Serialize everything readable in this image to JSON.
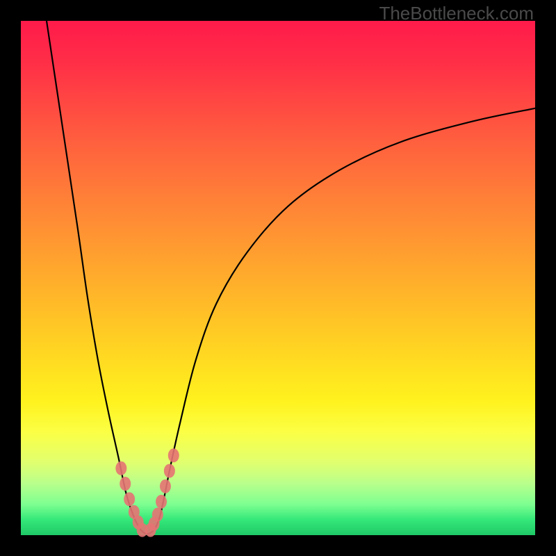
{
  "watermark": "TheBottleneck.com",
  "chart_data": {
    "type": "line",
    "title": "",
    "xlabel": "",
    "ylabel": "",
    "xlim": [
      0,
      100
    ],
    "ylim": [
      0,
      100
    ],
    "grid": false,
    "series": [
      {
        "name": "bottleneck-curve",
        "x": [
          5,
          8,
          11,
          13,
          15,
          17,
          19,
          20.5,
          22,
          23.2,
          24.2,
          25,
          26,
          27,
          28,
          29,
          31,
          34,
          38,
          44,
          52,
          62,
          74,
          88,
          100
        ],
        "y": [
          100,
          80,
          60,
          46,
          34,
          24,
          15,
          8,
          3.5,
          1.2,
          0.3,
          0.3,
          1.2,
          3.5,
          8,
          13,
          22,
          34,
          45,
          55,
          64,
          71,
          76.5,
          80.5,
          83
        ]
      }
    ],
    "markers": {
      "name": "highlighted-points",
      "x": [
        19.5,
        20.3,
        21.1,
        22.0,
        22.8,
        23.6,
        25.2,
        25.9,
        26.6,
        27.3,
        28.1,
        28.9,
        29.7
      ],
      "y": [
        13,
        10,
        7,
        4.5,
        2.5,
        1,
        1,
        2.2,
        4,
        6.5,
        9.5,
        12.5,
        15.5
      ]
    },
    "colors": {
      "curve": "#000000",
      "marker": "#e57373",
      "gradient_top": "#ff1a4a",
      "gradient_mid": "#ffd522",
      "gradient_bottom": "#1fc966"
    }
  }
}
